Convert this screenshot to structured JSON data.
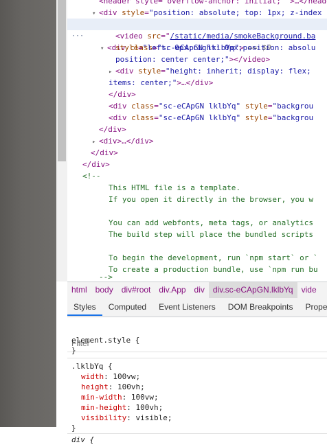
{
  "elements": {
    "lines": [
      {
        "indent": 0,
        "html": "&lt;header style=\"overflow-anchor: initial; \"…&lt;/header&gt;"
      },
      {
        "indent": 1,
        "html": "▾&lt;div style=\"position: absolute; top: 1px; z-index"
      },
      {
        "indent": 2,
        "html": "▾&lt;div class=\"sc-eCApGN lklbYq\"&gt; == $0"
      },
      {
        "indent": 3,
        "html": "&lt;video src=\"/static/media/smokeBackground.ba"
      },
      {
        "indent": 3,
        "html": "style=\"left: 0px;right: 0px;position: absolu"
      },
      {
        "indent": 3,
        "html": "position: center center;\"&gt;&lt;/video&gt;"
      },
      {
        "indent": 3,
        "html": "▸&lt;div style=\"height: inherit; display: flex; "
      },
      {
        "indent": 2,
        "html": "items: center;\"&gt;…&lt;/div&gt;"
      },
      {
        "indent": 2,
        "html": "&lt;/div&gt;"
      },
      {
        "indent": 2,
        "html": "&lt;div class=\"sc-eCApGN lklbYq\" style=\"backgroun"
      },
      {
        "indent": 2,
        "html": "&lt;div class=\"sc-eCApGN lklbYq\" style=\"backgroun"
      },
      {
        "indent": 1,
        "html": "&lt;/div&gt;"
      },
      {
        "indent": 1,
        "html": "▸&lt;div&gt;…&lt;/div&gt;"
      },
      {
        "indent": 0,
        "html": "&lt;/div&gt;"
      },
      {
        "indent": 0,
        "html": "&lt;/div&gt;"
      },
      {
        "indent": 0,
        "html": "&lt;!--"
      },
      {
        "indent": 0,
        "html": "This HTML file is a template."
      },
      {
        "indent": 0,
        "html": "If you open it directly in the browser, you w"
      },
      {
        "indent": 0,
        "html": ""
      },
      {
        "indent": 0,
        "html": "You can add webfonts, meta tags, or analytics"
      },
      {
        "indent": 0,
        "html": "The build step will place the bundled scripts"
      },
      {
        "indent": 0,
        "html": ""
      },
      {
        "indent": 0,
        "html": "To begin the development, run `npm start` or"
      },
      {
        "indent": 0,
        "html": "To create a production bundle, use `npm run bu"
      },
      {
        "indent": 0,
        "html": "--&gt;"
      }
    ]
  },
  "text": {
    "l0": "<header style=\"overflow-anchor: initial; \">…</header>",
    "l1_tag": "<div ",
    "l1_attr": "style",
    "l1_val": "\"position: absolute; top: 1px; z-index",
    "l2_tag": "<div ",
    "l2_attr": "class",
    "l2_val": "\"sc-eCApGN lklbYq\"",
    "l2_close": ">",
    "l2_eq": "== $0",
    "l3_tag": "<video ",
    "l3_attr": "src",
    "l3_link": "/static/media/smokeBackground.ba",
    "l4_attr": "style",
    "l4_val": "\"left: 0px;right: 0px;position: absolu",
    "l5_val": "position: center center;\"",
    "l5_tag": "></video>",
    "l6_tag": "<div ",
    "l6_attr": "style",
    "l6_val": "\"height: inherit; display: flex; ",
    "l7_val": "items: center;\"",
    "l7_tag": ">…</div>",
    "l8": "</div>",
    "l9_tag": "<div ",
    "l9_attr": "class",
    "l9_val": "\"sc-eCApGN lklbYq\"",
    "l9_attr2": " style",
    "l9_val2": "\"backgrou",
    "l10_tag": "<div ",
    "l10_attr": "class",
    "l10_val": "\"sc-eCApGN lklbYq\"",
    "l10_attr2": " style",
    "l10_val2": "\"backgrou",
    "l11": "</div>",
    "l12": "<div>…</div>",
    "l13": "</div>",
    "l14": "</div>",
    "l15": "<!--",
    "c1": "This HTML file is a template.",
    "c2": "If you open it directly in the browser, you w",
    "c3": "You can add webfonts, meta tags, or analytics",
    "c4": "The build step will place the bundled scripts",
    "c5": "To begin the development, run `npm start` or `",
    "c6": "To create a production bundle, use `npm run bu",
    "cend": "-->",
    "row_marker": "···"
  },
  "breadcrumb": [
    "html",
    "body",
    "div#root",
    "div.App",
    "div",
    "div.sc-eCApGN.lklbYq",
    "vide"
  ],
  "tabs": [
    "Styles",
    "Computed",
    "Event Listeners",
    "DOM Breakpoints",
    "Prope"
  ],
  "filter_placeholder": "Filter",
  "styles": {
    "element_style": "element.style {",
    "close1": "}",
    "rule_selector": ".lklbYq {",
    "props": [
      {
        "name": "width",
        "value": "100vw;"
      },
      {
        "name": "height",
        "value": "100vh;"
      },
      {
        "name": "min-width",
        "value": "100vw;"
      },
      {
        "name": "min-height",
        "value": "100vh;"
      },
      {
        "name": "visibility",
        "value": "visible;"
      }
    ],
    "close2": "}",
    "div_rule": "div {"
  }
}
